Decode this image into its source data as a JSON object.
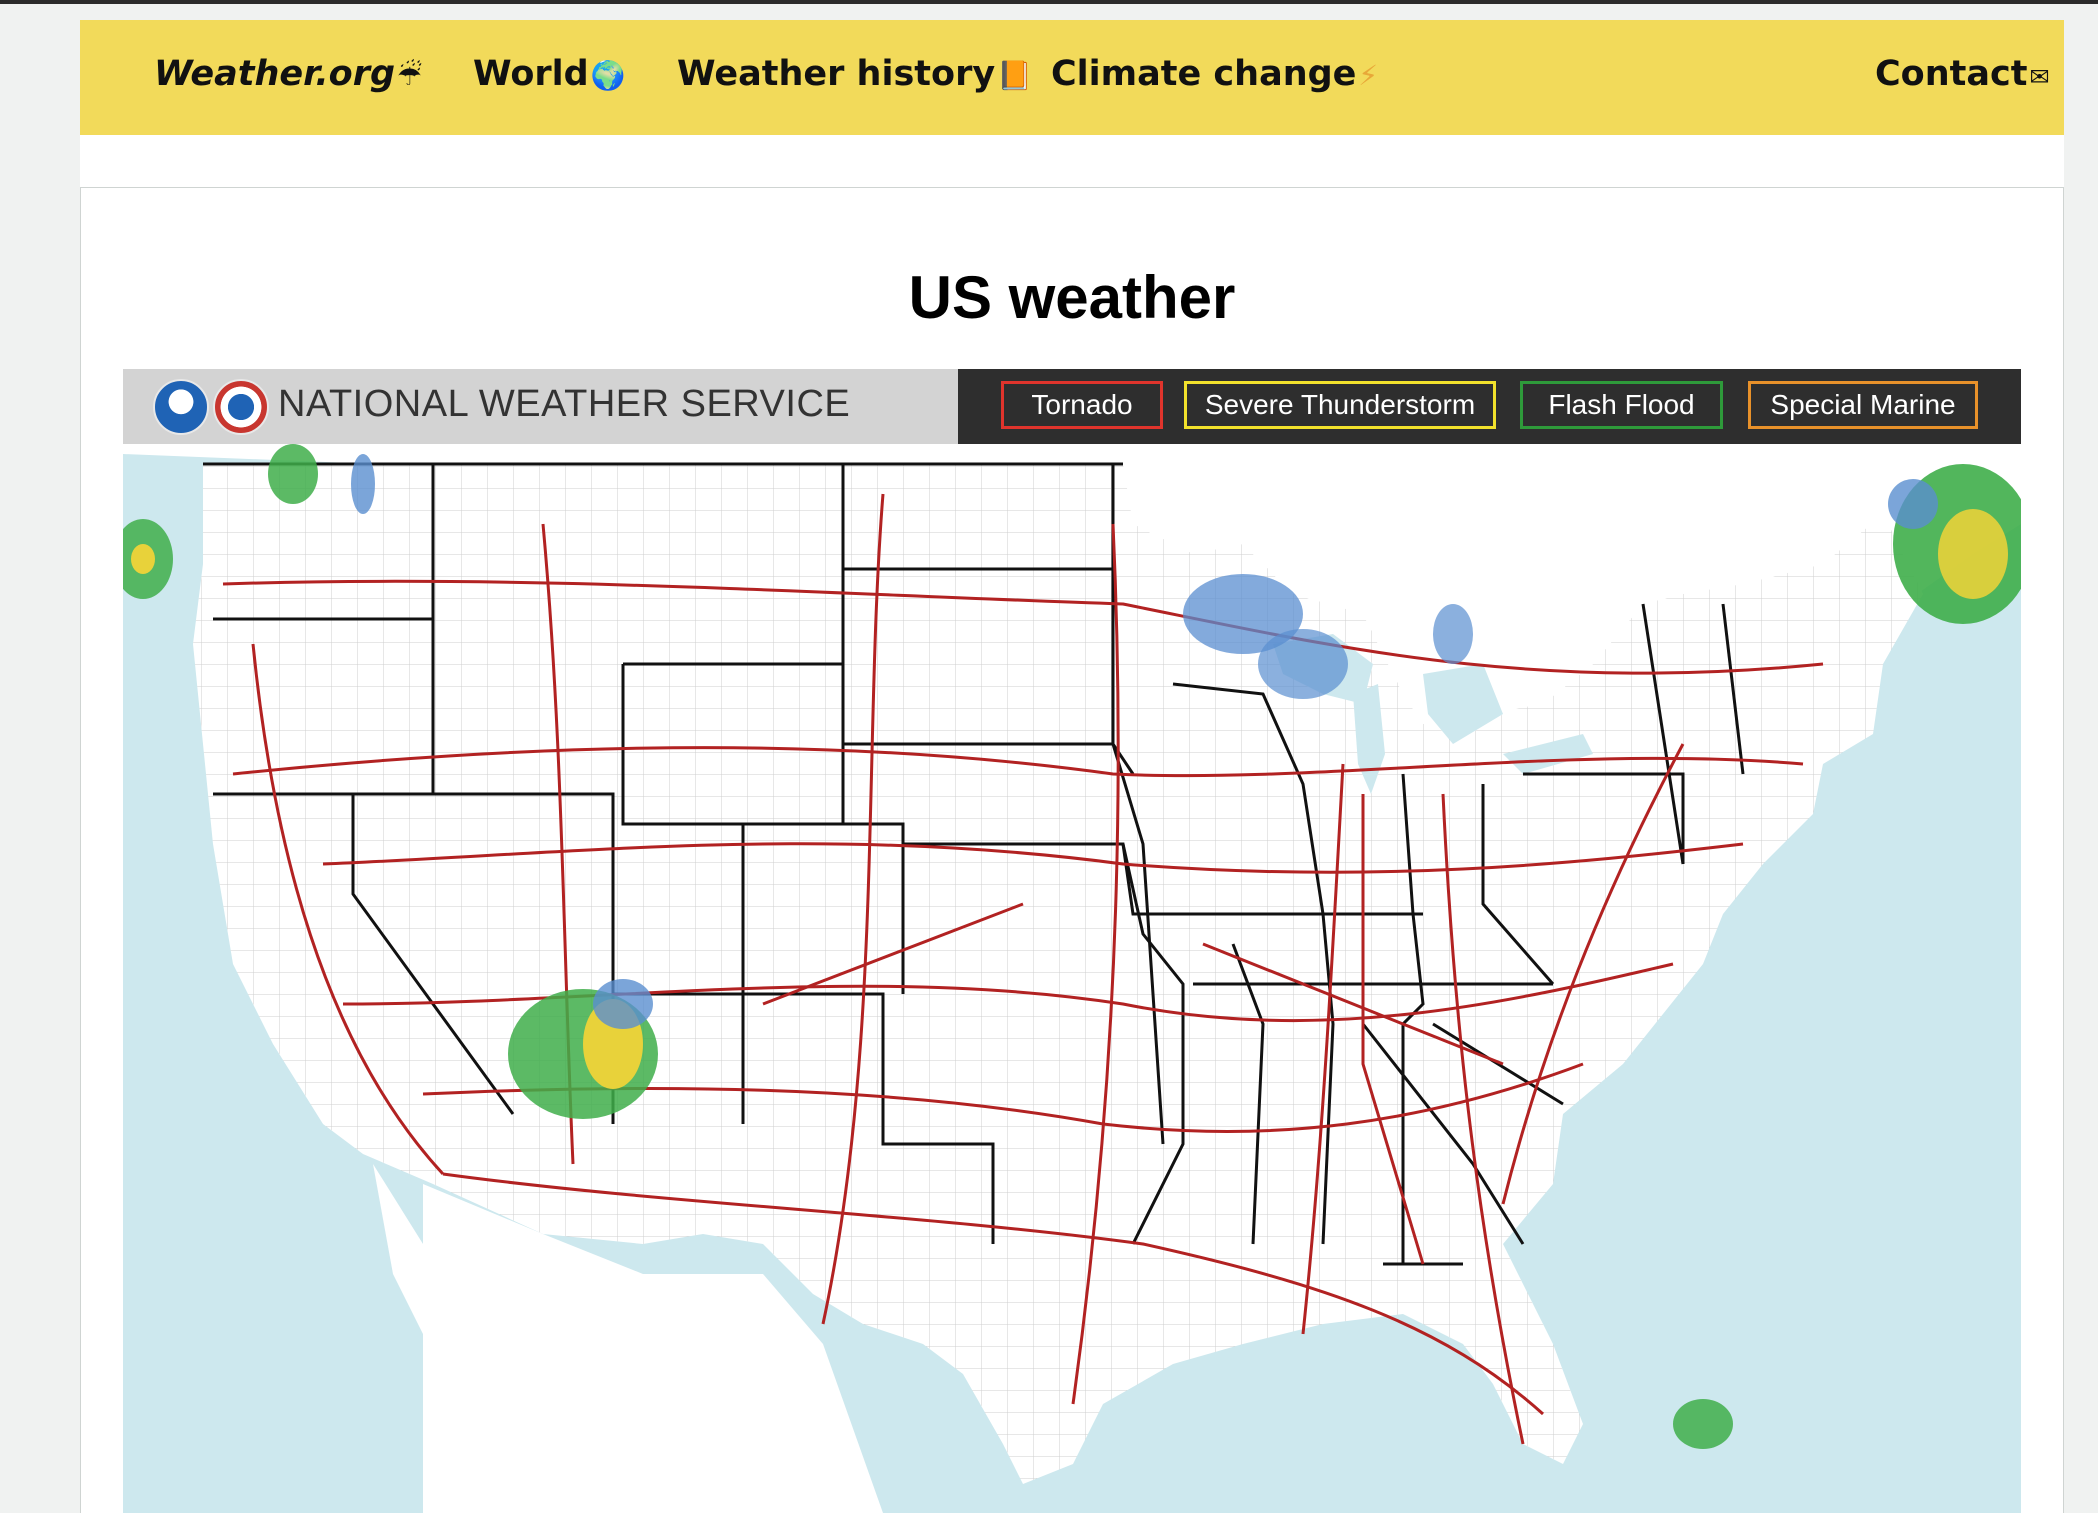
{
  "nav": {
    "brand": "Weather.org",
    "brand_icon": "umbrella-rain-icon",
    "items": [
      {
        "label": "World",
        "icon": "globe-icon",
        "glyph": "🌍"
      },
      {
        "label": "Weather history",
        "icon": "book-icon",
        "glyph": "📙"
      },
      {
        "label": "Climate change",
        "icon": "lightning-icon",
        "glyph": "⚡"
      }
    ],
    "contact": {
      "label": "Contact",
      "icon": "envelope-icon",
      "glyph": "✉"
    },
    "brand_glyph": "☔"
  },
  "page": {
    "title": "US weather"
  },
  "map": {
    "service_name": "NATIONAL WEATHER SERVICE",
    "logos": [
      "noaa-logo",
      "nws-logo"
    ],
    "legend": [
      {
        "label": "Tornado",
        "color": "#e0342c"
      },
      {
        "label": "Severe Thunderstorm",
        "color": "#f2e12c"
      },
      {
        "label": "Flash Flood",
        "color": "#2e9a3a"
      },
      {
        "label": "Special Marine",
        "color": "#e8912a"
      }
    ],
    "colors": {
      "water": "#cde8ee",
      "land": "#ffffff",
      "highways": "#b22222",
      "state_borders": "#111111",
      "county_lines": "#c8c8c8",
      "radar_light": "#5a8ed0",
      "radar_green": "#3fae4a",
      "radar_yellow": "#e8d23a"
    }
  },
  "theme": {
    "navbar_bg": "#f2da5a",
    "page_bg": "#f0f2f1"
  }
}
